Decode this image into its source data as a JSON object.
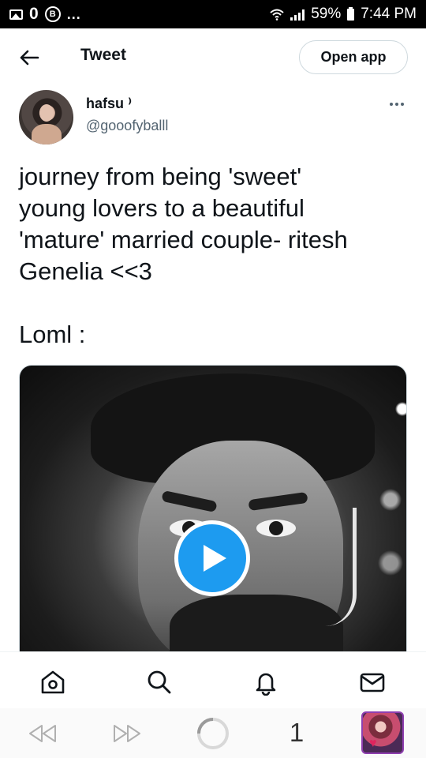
{
  "status_bar": {
    "battery": "59%",
    "time": "7:44 PM",
    "dots": "..."
  },
  "header": {
    "title": "Tweet",
    "open_app_label": "Open app"
  },
  "author": {
    "display_name": "hafsu ⁾",
    "handle": "@gooofyballl"
  },
  "tweet": {
    "lines": [
      "journey from being 'sweet'",
      "young lovers to a beautiful",
      "'mature' married couple- ritesh",
      "Genelia <<3"
    ],
    "loml": "Loml :"
  },
  "browser": {
    "tab_count": "1"
  },
  "colors": {
    "accent": "#1d9bf0",
    "text_primary": "#0f1419",
    "text_secondary": "#536471",
    "border": "#cfd9de"
  },
  "icons": {
    "back": "arrow-left-icon",
    "more": "more-horizontal-icon",
    "play": "play-icon",
    "home": "home-icon",
    "search": "search-icon",
    "notifications": "bell-icon",
    "messages": "envelope-icon"
  }
}
